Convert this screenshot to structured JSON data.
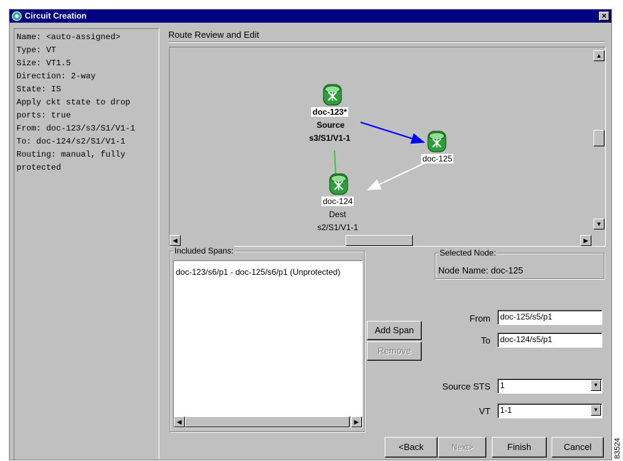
{
  "window": {
    "title": "Circuit Creation",
    "close_label": "×"
  },
  "info_panel": {
    "lines": [
      "Name: <auto-assigned>",
      "Type: VT",
      "Size: VT1.5",
      "Direction: 2-way",
      "State: IS",
      "Apply ckt state to drop",
      "ports: true",
      "",
      "From: doc-123/s3/S1/V1-1",
      "",
      "To: doc-124/s2/S1/V1-1",
      "",
      "Routing: manual, fully",
      "protected"
    ]
  },
  "route_review": {
    "label": "Route Review and Edit",
    "nodes": {
      "source": {
        "name": "doc-123*",
        "role": "Source",
        "port": "s3/S1/V1-1"
      },
      "middle": {
        "name": "doc-125"
      },
      "dest": {
        "name": "doc-124",
        "role": "Dest",
        "port": "s2/S1/V1-1"
      }
    },
    "link_colors": {
      "source_to_middle": "#0000ff",
      "middle_to_dest": "#ffffff",
      "source_to_dest": "#33cc33"
    }
  },
  "included_spans": {
    "label": "Included Spans:",
    "items": [
      "doc-123/s6/p1 - doc-125/s6/p1 (Unprotected)"
    ]
  },
  "selected_node": {
    "label": "Selected Node:",
    "node_name": "Node Name: doc-125"
  },
  "buttons": {
    "add_span": "Add Span",
    "remove": "Remove",
    "back": "<Back",
    "next": "Next>",
    "finish": "Finish",
    "cancel": "Cancel"
  },
  "form": {
    "from_label": "From",
    "from_value": "doc-125/s5/p1",
    "to_label": "To",
    "to_value": "doc-124/s5/p1",
    "source_sts_label": "Source STS",
    "source_sts_value": "1",
    "vt_label": "VT",
    "vt_value": "1-1"
  },
  "side_code": "83524"
}
